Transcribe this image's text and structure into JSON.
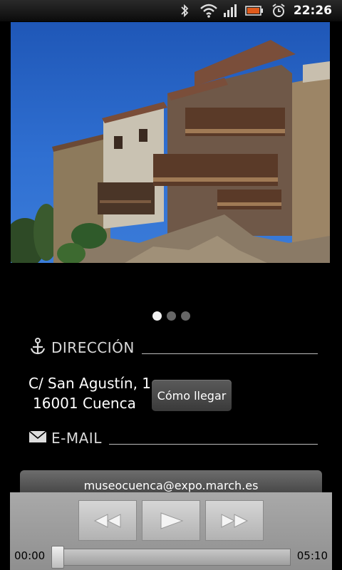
{
  "status_bar": {
    "time": "22:26",
    "icons": [
      "bluetooth-icon",
      "wifi-icon",
      "signal-icon",
      "battery-icon",
      "alarm-icon"
    ]
  },
  "photo": {
    "description_icon": "casas-colgadas-photo"
  },
  "pager": {
    "count": 3,
    "active": 0
  },
  "direccion": {
    "label": "DIRECCIÓN",
    "icon": "anchor-icon",
    "line1": "C/ San Agustín, 1",
    "line2": "16001 Cuenca",
    "button": "Cómo llegar"
  },
  "email": {
    "label": "E-MAIL",
    "icon": "envelope-icon",
    "address": "museocuenca@expo.march.es"
  },
  "player": {
    "current_time": "00:00",
    "total_time": "05:10",
    "progress": 0
  },
  "colors": {
    "accent": "#ffffff",
    "background": "#000000",
    "sky": "#2f6fd1"
  }
}
